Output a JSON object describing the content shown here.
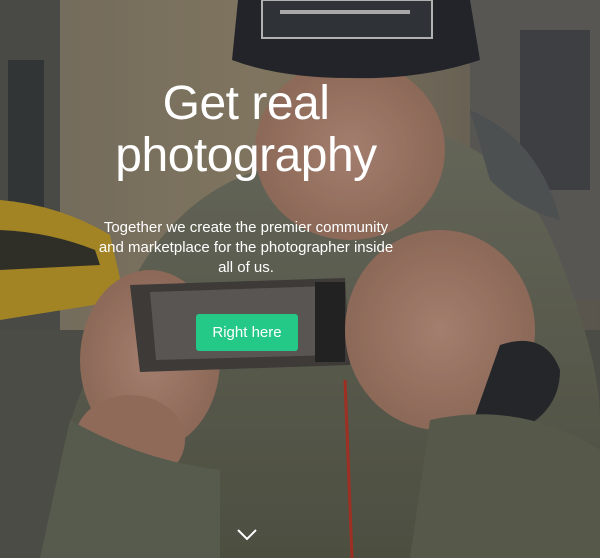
{
  "hero": {
    "headline_line1": "Get real",
    "headline_line2": "photography",
    "subtext_line1": "Together we create the premier community",
    "subtext_line2": "and marketplace for the photographer inside",
    "subtext_line3": "all of us.",
    "cta_label": "Right here",
    "cta_color": "#24c887",
    "scroll_icon": "chevron-down-icon"
  }
}
